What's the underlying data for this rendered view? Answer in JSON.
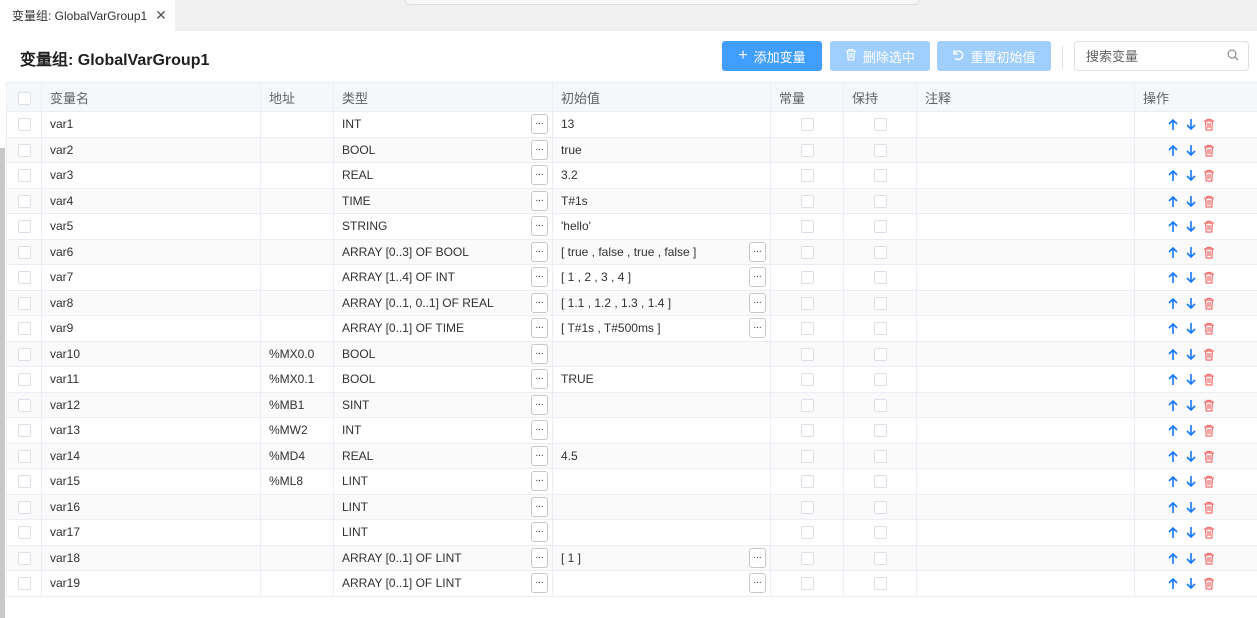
{
  "tab": {
    "label": "变量组: GlobalVarGroup1",
    "close": "✕"
  },
  "header": {
    "title": "变量组: GlobalVarGroup1",
    "add_label": "添加变量",
    "delete_label": "删除选中",
    "reset_label": "重置初始值",
    "search_placeholder": "搜索变量"
  },
  "columns": {
    "name": "变量名",
    "address": "地址",
    "type": "类型",
    "init": "初始值",
    "constant": "常量",
    "retain": "保持",
    "comment": "注释",
    "ops": "操作"
  },
  "ellipsis": "...",
  "colors": {
    "primary": "#409eff",
    "primary_disabled": "#a0cfff",
    "delete_icon": "#f56c6c",
    "arrow_icon": "#1677ff"
  },
  "icons": {
    "add": "plus-icon",
    "delete": "trash-icon",
    "reset": "undo-icon",
    "search": "search-icon",
    "up": "arrow-up-icon",
    "down": "arrow-down-icon"
  },
  "rows": [
    {
      "name": "var1",
      "address": "",
      "type": "INT",
      "init": "13",
      "init_btn": false
    },
    {
      "name": "var2",
      "address": "",
      "type": "BOOL",
      "init": "true",
      "init_btn": false
    },
    {
      "name": "var3",
      "address": "",
      "type": "REAL",
      "init": "3.2",
      "init_btn": false
    },
    {
      "name": "var4",
      "address": "",
      "type": "TIME",
      "init": "T#1s",
      "init_btn": false
    },
    {
      "name": "var5",
      "address": "",
      "type": "STRING",
      "init": "'hello'",
      "init_btn": false
    },
    {
      "name": "var6",
      "address": "",
      "type": "ARRAY [0..3] OF BOOL",
      "init": "[ true , false , true , false ]",
      "init_btn": true
    },
    {
      "name": "var7",
      "address": "",
      "type": "ARRAY [1..4] OF INT",
      "init": "[ 1 , 2 , 3 , 4 ]",
      "init_btn": true
    },
    {
      "name": "var8",
      "address": "",
      "type": "ARRAY [0..1, 0..1] OF REAL",
      "init": "[ 1.1 , 1.2 , 1.3 , 1.4 ]",
      "init_btn": true
    },
    {
      "name": "var9",
      "address": "",
      "type": "ARRAY [0..1] OF TIME",
      "init": "[ T#1s , T#500ms ]",
      "init_btn": true
    },
    {
      "name": "var10",
      "address": "%MX0.0",
      "type": "BOOL",
      "init": "",
      "init_btn": false
    },
    {
      "name": "var11",
      "address": "%MX0.1",
      "type": "BOOL",
      "init": "TRUE",
      "init_btn": false
    },
    {
      "name": "var12",
      "address": "%MB1",
      "type": "SINT",
      "init": "",
      "init_btn": false
    },
    {
      "name": "var13",
      "address": "%MW2",
      "type": "INT",
      "init": "",
      "init_btn": false
    },
    {
      "name": "var14",
      "address": "%MD4",
      "type": "REAL",
      "init": "4.5",
      "init_btn": false
    },
    {
      "name": "var15",
      "address": "%ML8",
      "type": "LINT",
      "init": "",
      "init_btn": false
    },
    {
      "name": "var16",
      "address": "",
      "type": "LINT",
      "init": "",
      "init_btn": false
    },
    {
      "name": "var17",
      "address": "",
      "type": "LINT",
      "init": "",
      "init_btn": false
    },
    {
      "name": "var18",
      "address": "",
      "type": "ARRAY [0..1] OF LINT",
      "init": "[ 1 ]",
      "init_btn": true
    },
    {
      "name": "var19",
      "address": "",
      "type": "ARRAY [0..1] OF LINT",
      "init": "",
      "init_btn": true
    }
  ]
}
